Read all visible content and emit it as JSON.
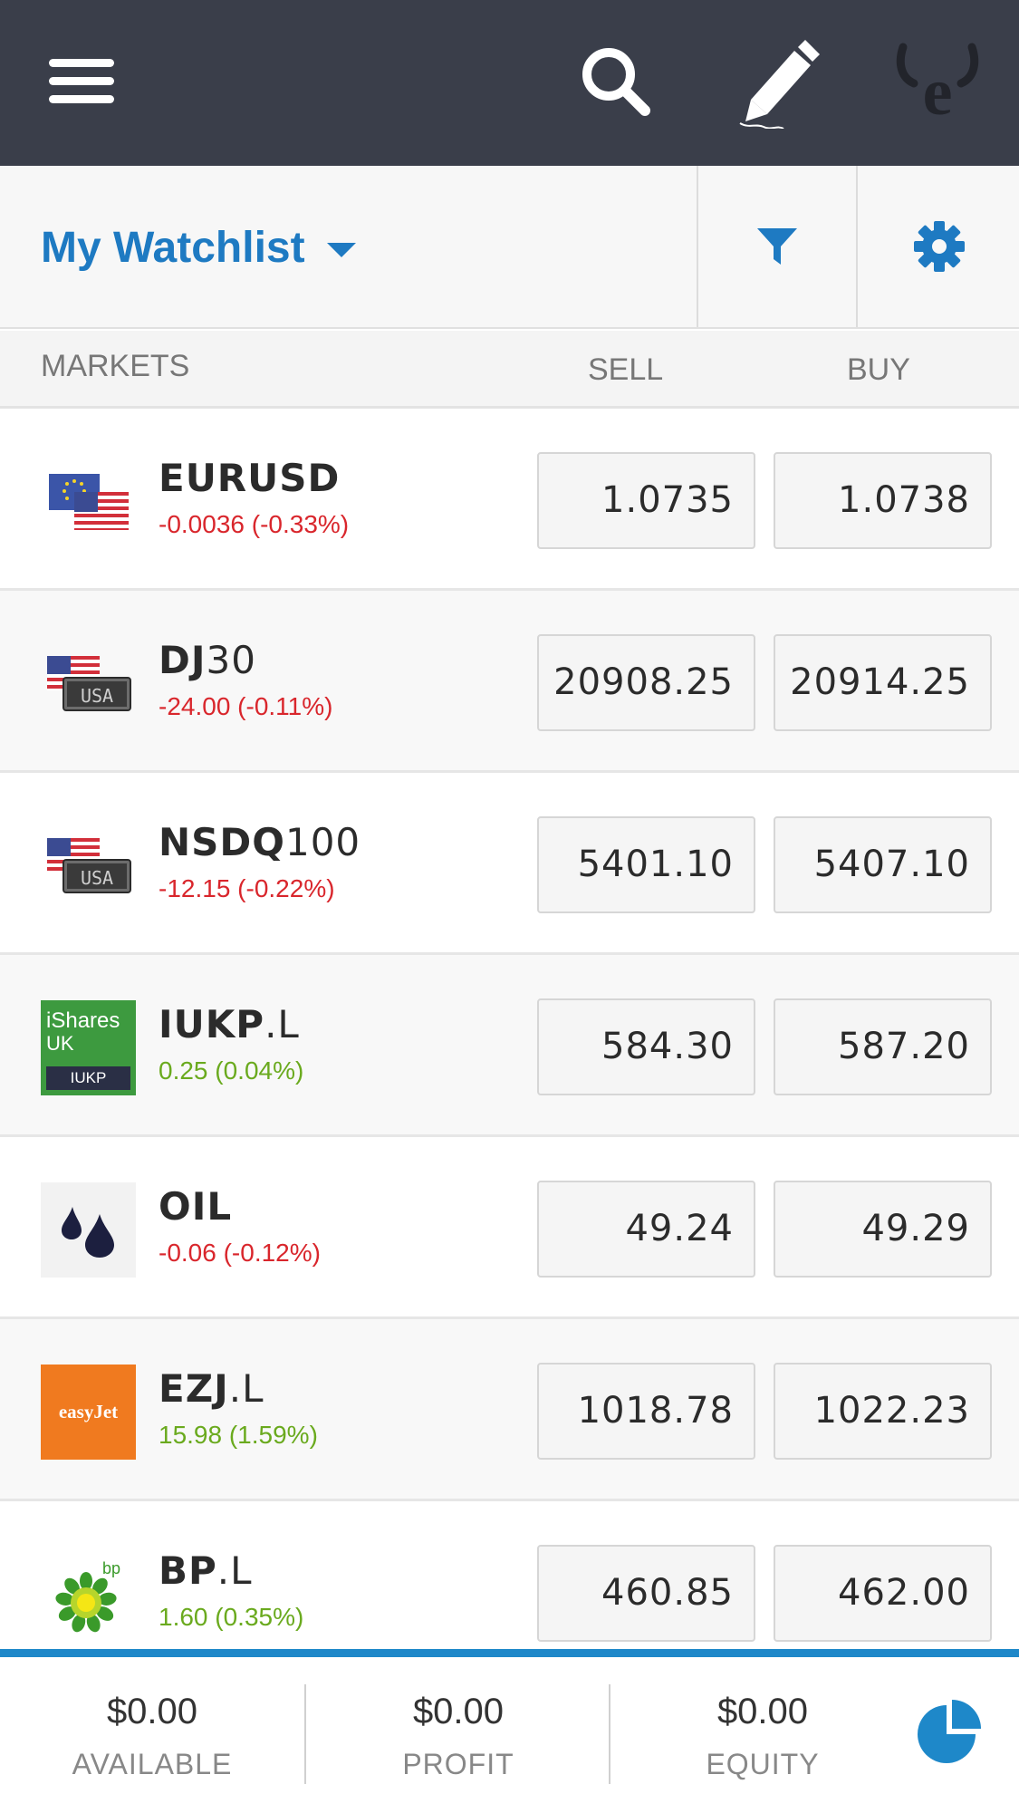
{
  "colors": {
    "topbar": "#3a3e4a",
    "accent": "#1e7ac2",
    "negative": "#d9262c",
    "positive": "#6aaa1e"
  },
  "topbar": {
    "icons": [
      "menu-icon",
      "search-icon",
      "edit-pencil-icon",
      "etoro-logo-icon"
    ]
  },
  "watchlist": {
    "title": "My Watchlist",
    "icons": [
      "caret-down-icon",
      "filter-icon",
      "gear-icon"
    ]
  },
  "columns": {
    "markets": "MARKETS",
    "sell": "SELL",
    "buy": "BUY"
  },
  "rows": [
    {
      "name_bold": "EURUSD",
      "name_light": "",
      "change": "-0.0036 (-0.33%)",
      "direction": "negative",
      "sell": "1.0735",
      "buy": "1.0738",
      "icon": "eu-us-flags-icon"
    },
    {
      "name_bold": "DJ",
      "name_light": "30",
      "change": "-24.00 (-0.11%)",
      "direction": "negative",
      "sell": "20908.25",
      "buy": "20914.25",
      "icon": "usa-flag-icon"
    },
    {
      "name_bold": "NSDQ",
      "name_light": "100",
      "change": "-12.15 (-0.22%)",
      "direction": "negative",
      "sell": "5401.10",
      "buy": "5407.10",
      "icon": "usa-flag-icon"
    },
    {
      "name_bold": "IUKP",
      "name_light": ".L",
      "change": "0.25 (0.04%)",
      "direction": "positive",
      "sell": "584.30",
      "buy": "587.20",
      "icon": "ishares-logo",
      "logo_text": [
        "iShares",
        "UK",
        "IUKP"
      ]
    },
    {
      "name_bold": "OIL",
      "name_light": "",
      "change": "-0.06 (-0.12%)",
      "direction": "negative",
      "sell": "49.24",
      "buy": "49.29",
      "icon": "oil-drops-icon"
    },
    {
      "name_bold": "EZJ",
      "name_light": ".L",
      "change": "15.98 (1.59%)",
      "direction": "positive",
      "sell": "1018.78",
      "buy": "1022.23",
      "icon": "easyjet-logo",
      "logo_text": [
        "easyJet"
      ]
    },
    {
      "name_bold": "BP",
      "name_light": ".L",
      "change": "1.60 (0.35%)",
      "direction": "positive",
      "sell": "460.85",
      "buy": "462.00",
      "icon": "bp-logo",
      "logo_text": [
        "bp"
      ]
    }
  ],
  "footer": {
    "available": {
      "amount": "$0.00",
      "label": "AVAILABLE"
    },
    "profit": {
      "amount": "$0.00",
      "label": "PROFIT"
    },
    "equity": {
      "amount": "$0.00",
      "label": "EQUITY"
    },
    "icon": "pie-chart-icon"
  }
}
